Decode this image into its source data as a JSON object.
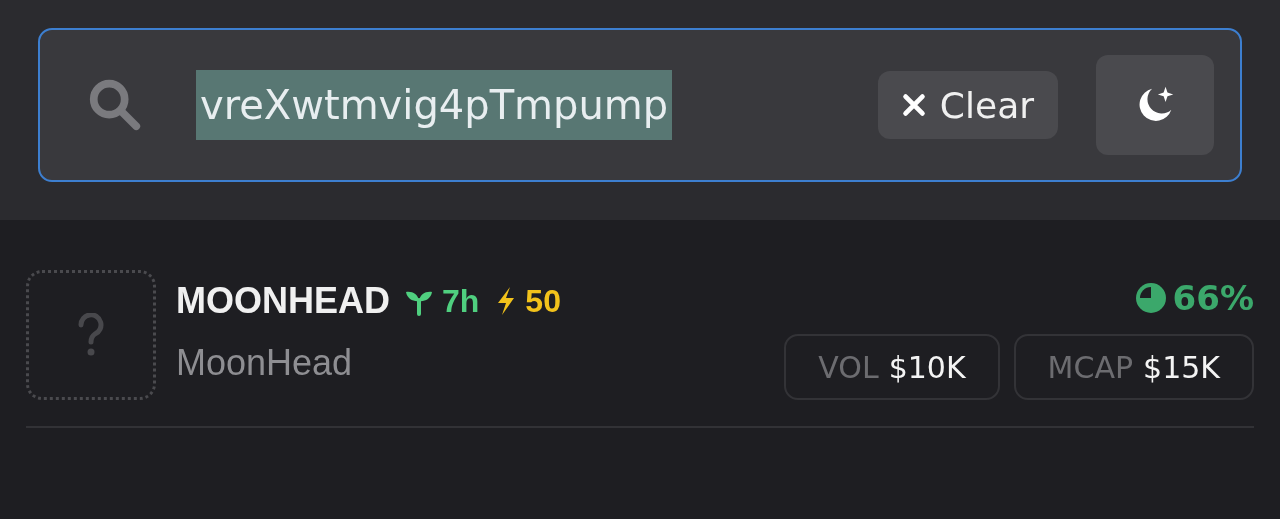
{
  "search": {
    "value": "vreXwtmvig4pTmpump",
    "text_selected": true,
    "clear_label": "Clear"
  },
  "results": [
    {
      "symbol": "MOONHEAD",
      "name": "MoonHead",
      "age": "7h",
      "score": "50",
      "percent": "66%",
      "stats": [
        {
          "label": "VOL",
          "value": "$10K"
        },
        {
          "label": "MCAP",
          "value": "$15K"
        }
      ]
    }
  ]
}
